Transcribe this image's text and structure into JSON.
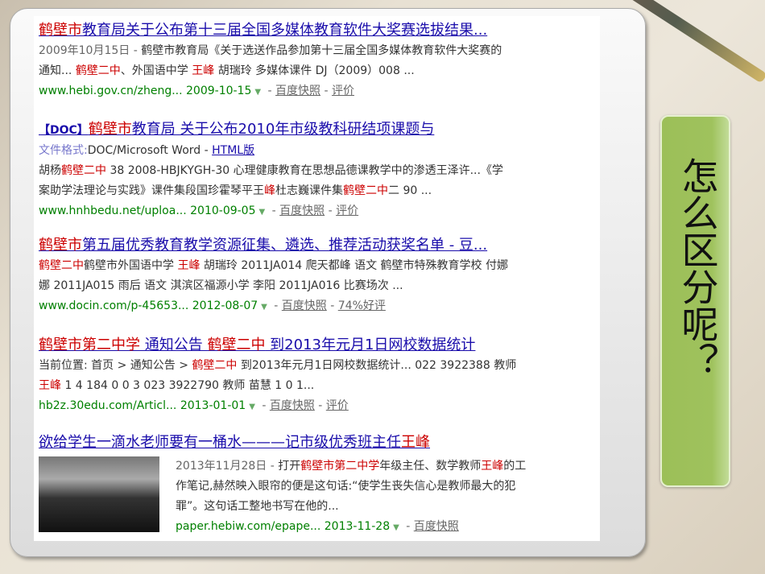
{
  "results": [
    {
      "title": [
        {
          "t": "鹤壁市",
          "hl": true
        },
        {
          "t": "教育局关于公布第十三届全国多媒体教育软件大奖赛选拔结果...",
          "hl": false
        }
      ],
      "lines": [
        [
          {
            "t": "2009年10月15日 - ",
            "d": true
          },
          {
            "t": " 鹤壁市教育局《关于选送作品参加第十三届全国多媒体教育软件大奖赛的"
          }
        ],
        [
          {
            "t": "通知... "
          },
          {
            "t": "鹤壁二中",
            "hl": true
          },
          {
            "t": "、外国语中学 "
          },
          {
            "t": "王峰",
            "hl": true
          },
          {
            "t": " 胡瑞玲 多媒体课件 DJ（2009）008 ..."
          }
        ]
      ],
      "url": "www.hebi.gov.cn/zheng... 2009-10-15",
      "links": [
        "百度快照",
        "评价"
      ]
    },
    {
      "doc_tag": "【DOC】",
      "title": [
        {
          "t": "鹤壁市",
          "hl": true
        },
        {
          "t": "教育局 关于公布2010年市级教科研结项课题与",
          "hl": false
        }
      ],
      "format_label": "文件格式:",
      "format_value": "DOC/Microsoft Word - ",
      "html_link": "HTML版",
      "lines": [
        [
          {
            "t": "胡杨"
          },
          {
            "t": "鹤壁二中",
            "hl": true
          },
          {
            "t": " 38 2008-HBJKYGH-30 心理健康教育在思想品德课教学中的渗透王泽许...《学"
          }
        ],
        [
          {
            "t": "案助学法理论与实践》课件集段国珍霍琴平王"
          },
          {
            "t": "峰",
            "hl": true
          },
          {
            "t": "杜志巍课件集"
          },
          {
            "t": "鹤壁二中",
            "hl": true
          },
          {
            "t": "二 90 ..."
          }
        ]
      ],
      "url": "www.hnhbedu.net/uploa... 2010-09-05",
      "links": [
        "百度快照",
        "评价"
      ]
    },
    {
      "title": [
        {
          "t": "鹤壁市",
          "hl": true
        },
        {
          "t": "第五届优秀教育教学资源征集、遴选、推荐活动获奖名单 - 豆...",
          "hl": false
        }
      ],
      "lines": [
        [
          {
            "t": "鹤壁二中",
            "hl": true
          },
          {
            "t": "鹤壁市外国语中学 "
          },
          {
            "t": "王峰",
            "hl": true
          },
          {
            "t": " 胡瑞玲 2011JA014 爬天都峰 语文 鹤壁市特殊教育学校 付娜"
          }
        ],
        [
          {
            "t": "娜 2011JA015 雨后 语文 淇滨区福源小学 李阳 2011JA016 比赛场次 ..."
          }
        ]
      ],
      "url": "www.docin.com/p-45653... 2012-08-07",
      "links": [
        "百度快照",
        "74%好评"
      ]
    },
    {
      "title": [
        {
          "t": "鹤壁市第二中学",
          "hl": true
        },
        {
          "t": " 通知公告 ",
          "hl": false
        },
        {
          "t": "鹤壁二中",
          "hl": true
        },
        {
          "t": " 到2013年元月1日网校数据统计",
          "hl": false
        }
      ],
      "lines": [
        [
          {
            "t": "当前位置: 首页 > 通知公告 > "
          },
          {
            "t": "鹤壁二中",
            "hl": true
          },
          {
            "t": " 到2013年元月1日网校数据统计... 022 3922388 教师"
          }
        ],
        [
          {
            "t": "王峰",
            "hl": true
          },
          {
            "t": " 1 4 184 0 0 3 023 3922790 教师 苗慧 1 0 1..."
          }
        ]
      ],
      "url": "hb2z.30edu.com/Articl... 2013-01-01",
      "links": [
        "百度快照",
        "评价"
      ]
    },
    {
      "title": [
        {
          "t": "欲给学生一滴水老师要有一桶水———记市级优秀班主任",
          "hl": false
        },
        {
          "t": "王峰",
          "hl": true
        }
      ],
      "lines": [
        [
          {
            "t": "2013年11月28日 - ",
            "d": true
          },
          {
            "t": " 打开"
          },
          {
            "t": "鹤壁市第二中学",
            "hl": true
          },
          {
            "t": "年级主任、数学教师"
          },
          {
            "t": "王峰",
            "hl": true
          },
          {
            "t": "的工"
          }
        ],
        [
          {
            "t": "作笔记,赫然映入眼帘的便是这句话:“使学生丧失信心是教师最大的犯"
          }
        ],
        [
          {
            "t": "罪”。这句话工整地书写在他的..."
          }
        ]
      ],
      "url": "paper.hebiw.com/epape... 2013-11-28",
      "links": [
        "百度快照"
      ]
    }
  ],
  "side_panel": {
    "text": "怎么区分呢？"
  },
  "colors": {
    "link": "#1a0dab",
    "highlight": "#cc0000",
    "url": "#008000",
    "panel": "#9fc25d"
  }
}
